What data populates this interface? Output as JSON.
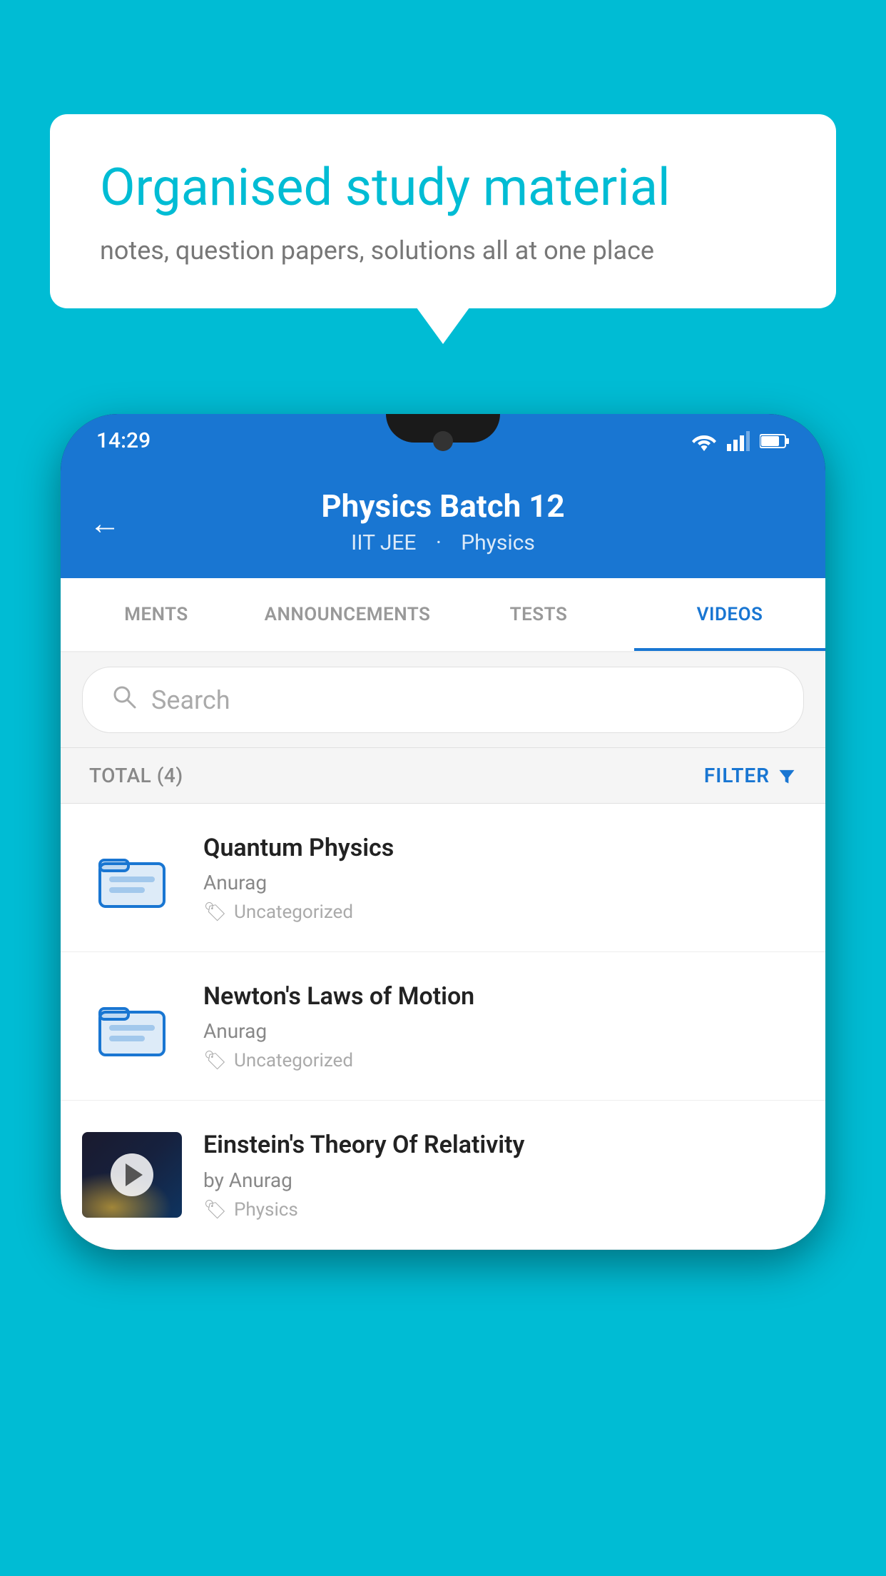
{
  "background": {
    "color": "#00BCD4"
  },
  "bubble": {
    "title": "Organised study material",
    "subtitle": "notes, question papers, solutions all at one place"
  },
  "statusBar": {
    "time": "14:29"
  },
  "header": {
    "title": "Physics Batch 12",
    "subtitle1": "IIT JEE",
    "subtitle2": "Physics",
    "back_label": "←"
  },
  "tabs": [
    {
      "label": "MENTS",
      "active": false
    },
    {
      "label": "ANNOUNCEMENTS",
      "active": false
    },
    {
      "label": "TESTS",
      "active": false
    },
    {
      "label": "VIDEOS",
      "active": true
    }
  ],
  "search": {
    "placeholder": "Search"
  },
  "filterBar": {
    "total": "TOTAL (4)",
    "filter_label": "FILTER"
  },
  "videos": [
    {
      "title": "Quantum Physics",
      "author": "Anurag",
      "tag": "Uncategorized",
      "type": "folder",
      "has_thumb": false
    },
    {
      "title": "Newton's Laws of Motion",
      "author": "Anurag",
      "tag": "Uncategorized",
      "type": "folder",
      "has_thumb": false
    },
    {
      "title": "Einstein's Theory Of Relativity",
      "author": "by Anurag",
      "tag": "Physics",
      "type": "video",
      "has_thumb": true
    }
  ]
}
